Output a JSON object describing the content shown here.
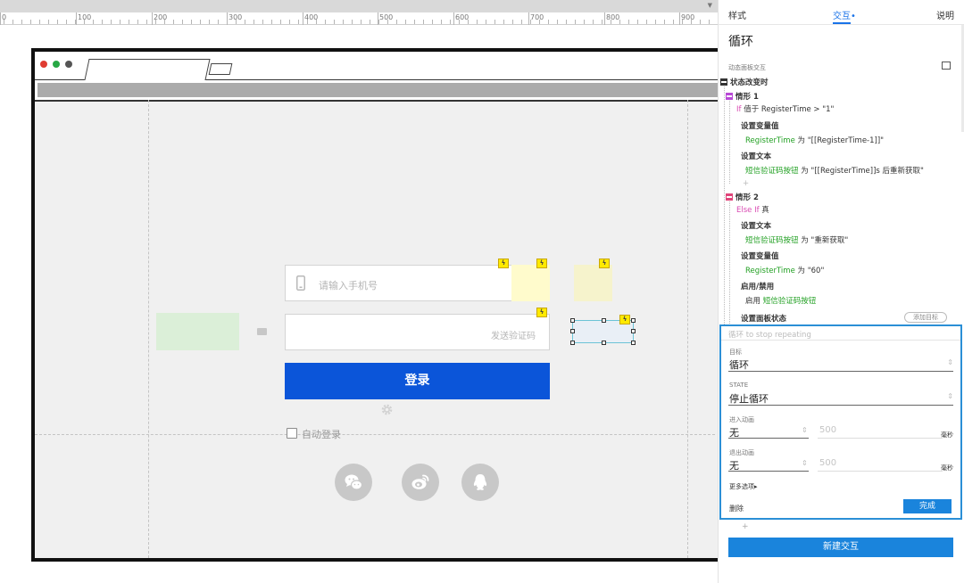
{
  "ruler": {
    "labels": [
      "0",
      "100",
      "200",
      "300",
      "400",
      "500",
      "600",
      "700",
      "800",
      "900"
    ]
  },
  "browser": {
    "dot_colors": [
      "#e03c31",
      "#27a844",
      "#555555"
    ]
  },
  "form": {
    "phone_placeholder": "请输入手机号",
    "sms_button": "发送验证码",
    "login_label": "登录",
    "auto_login": "自动登录",
    "login_color": "#0b55d9",
    "flag_glyph": "ϟ",
    "socials": [
      "wechat-icon",
      "weibo-icon",
      "qq-icon"
    ]
  },
  "panel": {
    "tabs": [
      "样式",
      "交互•",
      "说明"
    ],
    "title": "循环",
    "section_label": "动态面板交互",
    "event": "状态改变时",
    "case1": {
      "name": "情形 1",
      "cond_kw": "If",
      "cond_text": "值于 RegisterTime > \"1\"",
      "a1_title": "设置变量值",
      "a1_target": "RegisterTime",
      "a1_rest": " 为 \"[[RegisterTime-1]]\"",
      "a2_title": "设置文本",
      "a2_target": "短信验证码按钮",
      "a2_rest": " 为 \"[[RegisterTime]]s 后重新获取\"",
      "plus": "+"
    },
    "case2": {
      "name": "情形 2",
      "cond_kw": "Else If",
      "cond_text": "真",
      "a1_title": "设置文本",
      "a1_target": "短信验证码按钮",
      "a1_rest": " 为 \"重新获取\"",
      "a2_title": "设置变量值",
      "a2_target": "RegisterTime",
      "a2_rest": " 为 \"60\"",
      "a3_title": "启用/禁用",
      "a3_prefix": "启用 ",
      "a3_target": "短信验证码按钮",
      "a4_title": "设置面板状态",
      "add_target": "添加目标"
    },
    "editor": {
      "hint": "循环 to stop repeating",
      "target_label": "目标",
      "target_value": "循环",
      "state_label": "STATE",
      "state_value": "停止循环",
      "in_label": "进入动画",
      "in_value": "无",
      "in_ms": "500",
      "out_label": "退出动画",
      "out_value": "无",
      "out_ms": "500",
      "unit": "毫秒",
      "updown": "⇕",
      "more": "更多选项▸",
      "delete": "删除",
      "done": "完成"
    },
    "plus": "+",
    "new_interaction": "新建交互"
  }
}
